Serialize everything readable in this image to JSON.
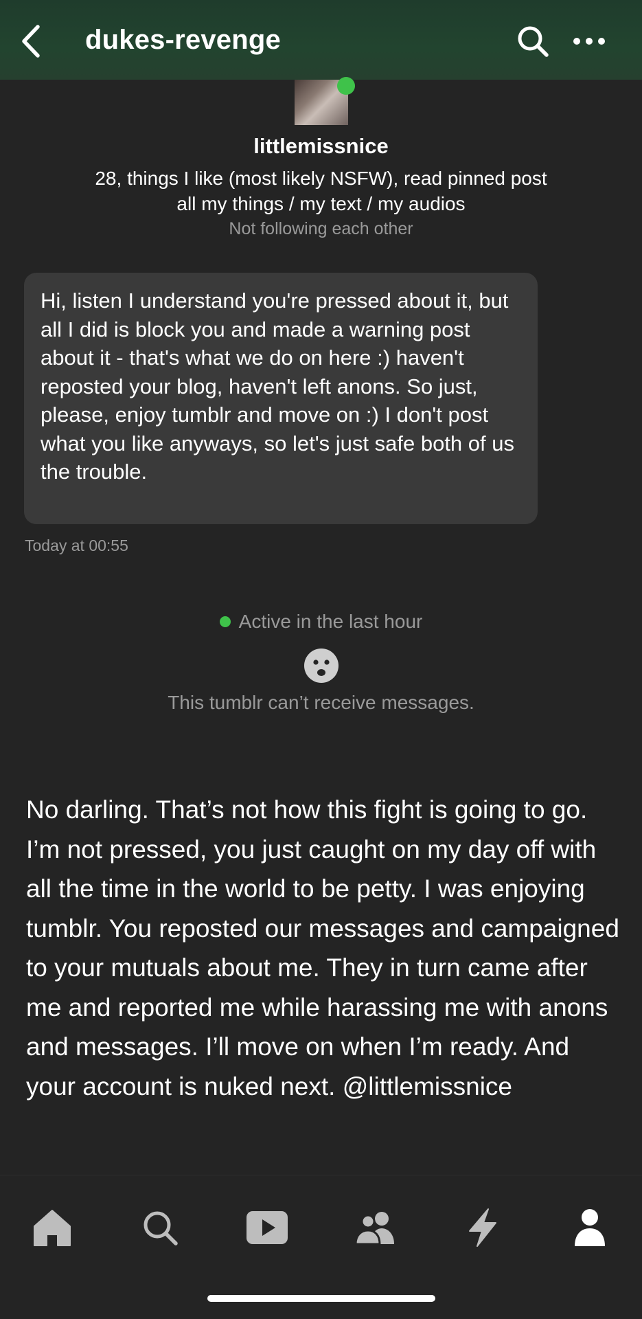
{
  "header": {
    "title": "dukes-revenge",
    "back_icon": "chevron-left-icon",
    "search_icon": "search-icon",
    "more_icon": "more-horizontal-icon",
    "background": "#22442f"
  },
  "profile": {
    "name": "littlemissnice",
    "description_line1": "28, things I like (most likely NSFW), read pinned post",
    "description_line2": "all my things / my text / my audios",
    "follow_status": "Not following each other",
    "online_color": "#3fc24a"
  },
  "message": {
    "text": "Hi, listen I understand you're pressed about it, but all I did is block you and made a warning post about it - that's what we do on here :) haven't reposted your blog, haven't left anons. So just, please, enjoy tumblr and move on :) I don't post what you like anyways, so let's just safe both of us the trouble.",
    "timestamp": "Today at 00:55"
  },
  "status": {
    "active": "Active in the last hour",
    "cant_receive": "This tumblr can’t receive messages.",
    "icon": "sad-face-icon"
  },
  "reply": {
    "text": "No darling. That’s not how this fight is going to go. I’m not pressed, you just caught on my day off with all the time in the world to be petty. I was enjoying tumblr. You reposted our messages and campaigned to your mutuals about me. They in turn came after me and reported me while harassing me with anons and messages. I’ll move on when I’m ready. And your account is nuked next. @littlemissnice"
  },
  "tabbar": {
    "items": [
      {
        "icon": "home-icon"
      },
      {
        "icon": "search-icon"
      },
      {
        "icon": "video-play-icon"
      },
      {
        "icon": "people-icon"
      },
      {
        "icon": "lightning-icon"
      },
      {
        "icon": "profile-icon"
      }
    ]
  }
}
